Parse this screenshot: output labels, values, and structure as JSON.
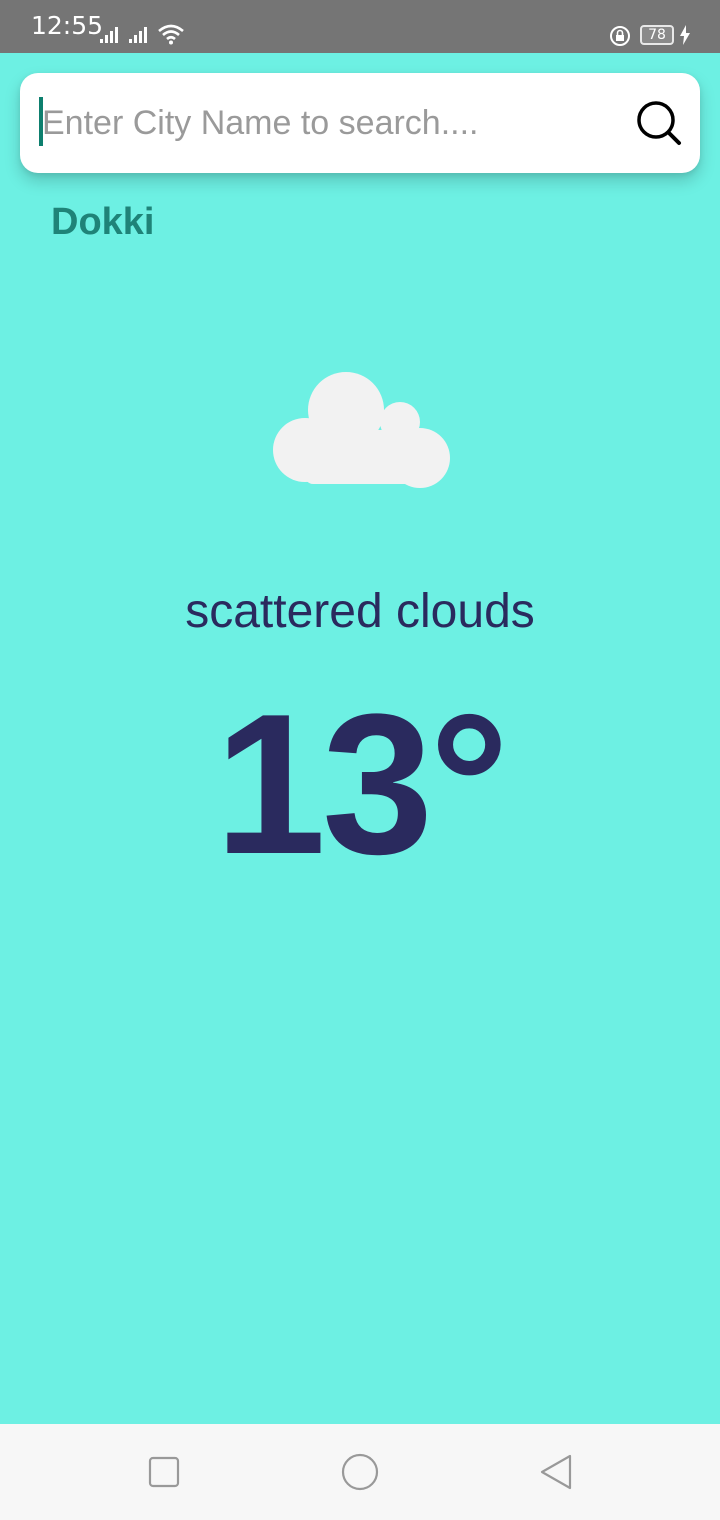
{
  "status_bar": {
    "time": "12:55",
    "battery": "78"
  },
  "search": {
    "placeholder": "Enter City Name to search....",
    "value": ""
  },
  "weather": {
    "city": "Dokki",
    "description": "scattered clouds",
    "temperature": "13°",
    "icon": "cloud-icon"
  },
  "colors": {
    "background": "#6df0e3",
    "city_text": "#1f8378",
    "main_text": "#2a2a5e",
    "status_bar": "#757575",
    "nav_bar": "#f7f7f7"
  },
  "nav": {
    "recents_icon": "square-icon",
    "home_icon": "circle-icon",
    "back_icon": "triangle-back-icon"
  }
}
